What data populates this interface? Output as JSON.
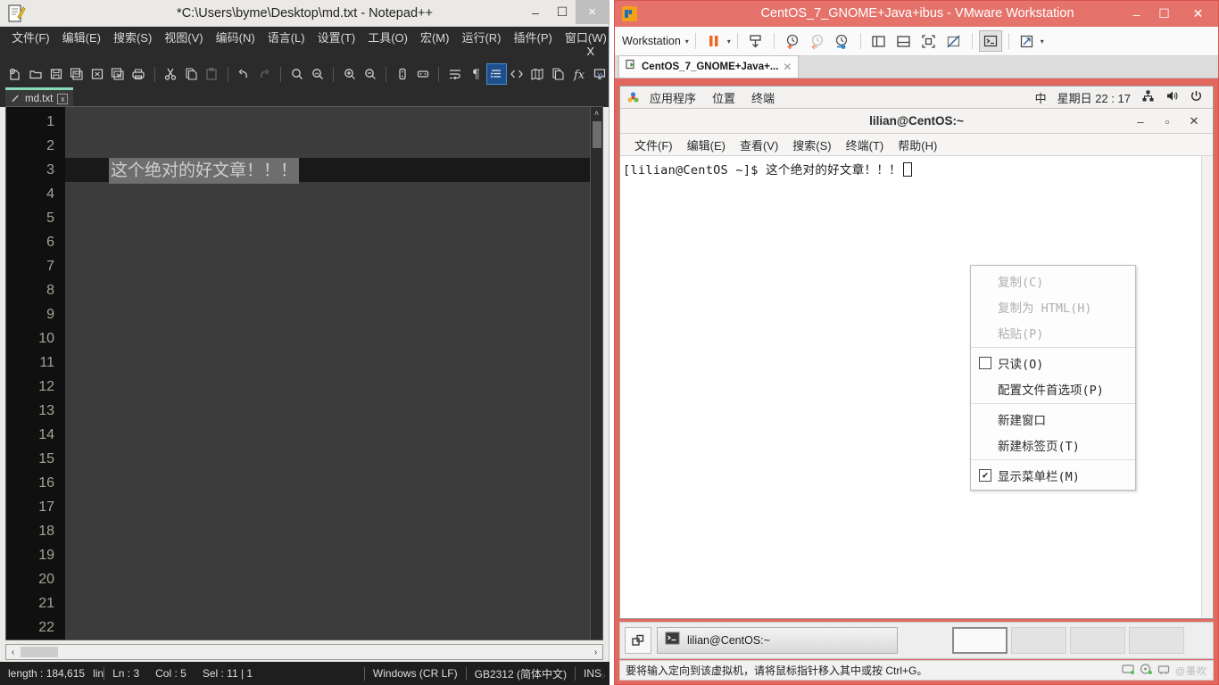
{
  "notepad": {
    "title": "*C:\\Users\\byme\\Desktop\\md.txt - Notepad++",
    "window_buttons": {
      "minimize": "–",
      "maximize": "☐",
      "close": "×"
    },
    "menu": [
      "文件(F)",
      "编辑(E)",
      "搜索(S)",
      "视图(V)",
      "编码(N)",
      "语言(L)",
      "设置(T)",
      "工具(O)",
      "宏(M)",
      "运行(R)",
      "插件(P)",
      "窗口(W)",
      "?"
    ],
    "doc_close_label": "X",
    "toolbar_overflow": "»",
    "toolbar_icons": [
      "new-file-icon",
      "open-folder-icon",
      "save-icon",
      "save-all-icon",
      "close-file-icon",
      "close-all-icon",
      "print-icon",
      "cut-icon",
      "copy-icon",
      "paste-icon",
      "undo-icon",
      "redo-icon",
      "find-icon",
      "replace-icon",
      "zoom-in-icon",
      "zoom-out-icon",
      "sync-scroll-v-icon",
      "sync-scroll-h-icon",
      "word-wrap-icon",
      "show-all-chars-icon",
      "indent-guide-icon",
      "show-tags-icon",
      "document-map-icon",
      "function-list-icon",
      "macro-fx-icon",
      "run-monitor-icon"
    ],
    "tab": {
      "label": "md.txt",
      "close": "⌧",
      "modified_icon": "pencil-icon"
    },
    "editor": {
      "line_numbers": [
        1,
        2,
        3,
        4,
        5,
        6,
        7,
        8,
        9,
        10,
        11,
        12,
        13,
        14,
        15,
        16,
        17,
        18,
        19,
        20,
        21,
        22
      ],
      "selected_line": 3,
      "selected_text": "这个绝对的好文章！！！"
    },
    "scroll": {
      "up_arrow": "˄",
      "left_arrow": "‹",
      "right_arrow": "›"
    },
    "statusbar": {
      "length": "length : 184,615",
      "lines": "lin",
      "ln": "Ln : 3",
      "col": "Col : 5",
      "sel": "Sel : 11 | 1",
      "eol": "Windows (CR LF)",
      "encoding": "GB2312 (简体中文)",
      "insert_mode": "INS"
    }
  },
  "vmware": {
    "title": "CentOS_7_GNOME+Java+ibus - VMware Workstation",
    "window_buttons": {
      "minimize": "–",
      "maximize": "☐",
      "close": "✕"
    },
    "toolbar": {
      "workstation_label": "Workstation",
      "caret": "▾",
      "icons": [
        "pause-vm-icon",
        "pause-dropdown-caret",
        "send-ctrl-alt-del-icon",
        "snapshot-take-icon",
        "snapshot-revert-icon",
        "snapshot-manager-icon",
        "show-library-icon",
        "show-thumbnails-icon",
        "full-screen-icon",
        "unity-mode-icon",
        "console-view-icon",
        "stretch-view-icon"
      ]
    },
    "tab": {
      "label": "CentOS_7_GNOME+Java+...",
      "close": "✕"
    },
    "taskbar": {
      "restore_icon": "restore-window-icon",
      "task_label": "lilian@CentOS:~",
      "task_icon": "terminal-icon",
      "workspaces": 4,
      "active_workspace": 1
    },
    "statusbar": {
      "message": "要将输入定向到该虚拟机，请将鼠标指针移入其中或按 Ctrl+G。",
      "watermark": "@墨吹"
    }
  },
  "gnome": {
    "panel": {
      "apps_icon": "gnome-applications-icon",
      "menus": [
        "应用程序",
        "位置",
        "终端"
      ],
      "input_method": "中",
      "clock": "星期日 22 : 17",
      "tray": [
        "network-icon",
        "volume-icon",
        "power-icon"
      ]
    }
  },
  "terminal": {
    "title": "lilian@CentOS:~",
    "window_buttons": {
      "minimize": "–",
      "maximize": "▫",
      "close": "✕"
    },
    "menu": [
      "文件(F)",
      "编辑(E)",
      "查看(V)",
      "搜索(S)",
      "终端(T)",
      "帮助(H)"
    ],
    "prompt": "[lilian@CentOS ~]$ 这个绝对的好文章！！！"
  },
  "context_menu": {
    "items": [
      {
        "label": "复制(C)",
        "disabled": true,
        "type": "plain"
      },
      {
        "label": "复制为 HTML(H)",
        "disabled": true,
        "type": "plain"
      },
      {
        "label": "粘贴(P)",
        "disabled": true,
        "type": "plain"
      },
      {
        "label": "只读(O)",
        "disabled": false,
        "type": "checkbox",
        "checked": false
      },
      {
        "label": "配置文件首选项(P)",
        "disabled": false,
        "type": "plain"
      },
      {
        "label": "新建窗口",
        "disabled": false,
        "type": "plain"
      },
      {
        "label": "新建标签页(T)",
        "disabled": false,
        "type": "plain"
      },
      {
        "label": "显示菜单栏(M)",
        "disabled": false,
        "type": "checkbox",
        "checked": true
      }
    ],
    "check_glyph": "✔"
  },
  "colors": {
    "vmware_accent": "#e2675f",
    "npp_editor_bg": "#3c3c3c",
    "npp_gutter_bg": "#101010",
    "npp_selection": "#6e6e6e",
    "npp_toolbar_active": "#1d4f8c",
    "npp_tab_accent": "#88dbb6"
  }
}
